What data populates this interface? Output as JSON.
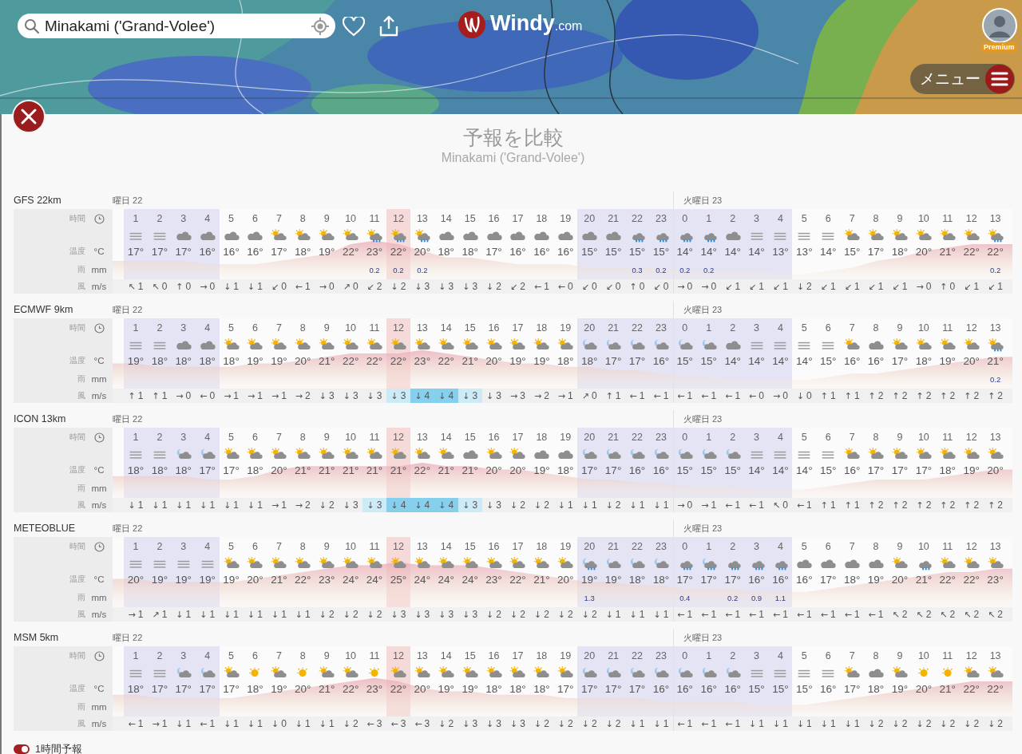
{
  "search": {
    "value": "Minakami ('Grand-Volee')"
  },
  "logo": {
    "name": "Windy",
    "suffix": ".com"
  },
  "account": {
    "badge": "Premium"
  },
  "menu": {
    "label": "メニュー"
  },
  "panel": {
    "title": "予報を比較",
    "subtitle": "Minakami ('Grand-Volee')"
  },
  "models": [
    {
      "name": "GFS 22km",
      "day": "曜日 22",
      "labels": {
        "time": "時間",
        "temperature": "温度",
        "temperature_unit": "°C",
        "rain": "雨",
        "rain_unit": "mm",
        "wind": "風",
        "wind_unit": "m/s"
      },
      "columns": [
        {
          "hour": "1",
          "kind": "fog",
          "temp": "17°",
          "wind": "1",
          "dir": "↖",
          "night": true,
          "now": false
        },
        {
          "hour": "2",
          "kind": "fog",
          "temp": "17°",
          "wind": "0",
          "dir": "↖",
          "night": true,
          "now": false
        },
        {
          "hour": "3",
          "kind": "cloud",
          "temp": "17°",
          "wind": "0",
          "dir": "↑",
          "night": true,
          "now": false
        },
        {
          "hour": "4",
          "kind": "cloud",
          "temp": "16°",
          "wind": "0",
          "dir": "→",
          "night": true,
          "now": false
        },
        {
          "hour": "5",
          "kind": "cloud",
          "temp": "16°",
          "wind": "1",
          "dir": "↓",
          "night": false,
          "now": false
        },
        {
          "hour": "6",
          "kind": "cloud",
          "temp": "16°",
          "wind": "1",
          "dir": "↓",
          "night": false,
          "now": false
        },
        {
          "hour": "7",
          "kind": "sun-cloud",
          "temp": "17°",
          "wind": "0",
          "dir": "↙",
          "night": false,
          "now": false
        },
        {
          "hour": "8",
          "kind": "sun-cloud",
          "temp": "18°",
          "wind": "1",
          "dir": "←",
          "night": false,
          "now": false
        },
        {
          "hour": "9",
          "kind": "sun-cloud",
          "temp": "19°",
          "wind": "0",
          "dir": "→",
          "night": false,
          "now": false
        },
        {
          "hour": "10",
          "kind": "sun-cloud",
          "temp": "22°",
          "wind": "0",
          "dir": "↗",
          "night": false,
          "now": false
        },
        {
          "hour": "11",
          "kind": "sun-cloud-rain",
          "temp": "23°",
          "rain": "0.2",
          "wind": "2",
          "dir": "↙",
          "night": false,
          "now": false
        },
        {
          "hour": "12",
          "kind": "sun-cloud-rain",
          "temp": "22°",
          "rain": "0.2",
          "wind": "2",
          "dir": "↓",
          "night": false,
          "now": true
        },
        {
          "hour": "13",
          "kind": "sun-cloud-rain",
          "temp": "20°",
          "rain": "0.2",
          "wind": "3",
          "dir": "↓",
          "night": false,
          "now": false
        },
        {
          "hour": "14",
          "kind": "cloud",
          "temp": "18°",
          "wind": "3",
          "dir": "↓",
          "night": false,
          "now": false
        },
        {
          "hour": "15",
          "kind": "cloud",
          "temp": "18°",
          "wind": "3",
          "dir": "↓",
          "night": false,
          "now": false
        },
        {
          "hour": "16",
          "kind": "cloud",
          "temp": "17°",
          "wind": "2",
          "dir": "↓",
          "night": false,
          "now": false
        },
        {
          "hour": "17",
          "kind": "cloud",
          "temp": "16°",
          "wind": "2",
          "dir": "↙",
          "night": false,
          "now": false
        },
        {
          "hour": "18",
          "kind": "cloud",
          "temp": "16°",
          "wind": "1",
          "dir": "←",
          "night": false,
          "now": false
        },
        {
          "hour": "19",
          "kind": "cloud",
          "temp": "16°",
          "wind": "0",
          "dir": "←",
          "night": false,
          "now": false
        },
        {
          "hour": "20",
          "kind": "cloud",
          "temp": "15°",
          "wind": "0",
          "dir": "↙",
          "night": true,
          "now": false
        },
        {
          "hour": "21",
          "kind": "cloud",
          "temp": "15°",
          "wind": "0",
          "dir": "↙",
          "night": true,
          "now": false
        },
        {
          "hour": "22",
          "kind": "cloud-rain",
          "temp": "15°",
          "rain": "0.3",
          "wind": "0",
          "dir": "↑",
          "night": true,
          "now": false
        },
        {
          "hour": "23",
          "kind": "cloud-rain",
          "temp": "15°",
          "rain": "0.2",
          "wind": "0",
          "dir": "↙",
          "night": true,
          "now": false
        },
        {
          "hour": "0",
          "kind": "cloud-rain",
          "temp": "14°",
          "rain": "0.2",
          "wind": "0",
          "dir": "→",
          "night": true,
          "now": false,
          "day": "火曜日 23"
        },
        {
          "hour": "1",
          "kind": "cloud-rain",
          "temp": "14°",
          "rain": "0.2",
          "wind": "0",
          "dir": "→",
          "night": true,
          "now": false
        },
        {
          "hour": "2",
          "kind": "cloud",
          "temp": "14°",
          "wind": "1",
          "dir": "↙",
          "night": true,
          "now": false
        },
        {
          "hour": "3",
          "kind": "fog",
          "temp": "14°",
          "wind": "1",
          "dir": "↙",
          "night": true,
          "now": false
        },
        {
          "hour": "4",
          "kind": "fog",
          "temp": "13°",
          "wind": "1",
          "dir": "↙",
          "night": true,
          "now": false
        },
        {
          "hour": "5",
          "kind": "fog",
          "temp": "13°",
          "wind": "2",
          "dir": "↓",
          "night": false,
          "now": false
        },
        {
          "hour": "6",
          "kind": "fog",
          "temp": "14°",
          "wind": "1",
          "dir": "↙",
          "night": false,
          "now": false
        },
        {
          "hour": "7",
          "kind": "sun-cloud",
          "temp": "15°",
          "wind": "1",
          "dir": "↙",
          "night": false,
          "now": false
        },
        {
          "hour": "8",
          "kind": "sun-cloud",
          "temp": "17°",
          "wind": "1",
          "dir": "↙",
          "night": false,
          "now": false
        },
        {
          "hour": "9",
          "kind": "sun-cloud",
          "temp": "18°",
          "wind": "1",
          "dir": "↙",
          "night": false,
          "now": false
        },
        {
          "hour": "10",
          "kind": "sun-cloud",
          "temp": "20°",
          "wind": "0",
          "dir": "→",
          "night": false,
          "now": false
        },
        {
          "hour": "11",
          "kind": "sun-cloud",
          "temp": "21°",
          "wind": "0",
          "dir": "↑",
          "night": false,
          "now": false
        },
        {
          "hour": "12",
          "kind": "sun-cloud",
          "temp": "22°",
          "wind": "1",
          "dir": "↙",
          "night": false,
          "now": false
        },
        {
          "hour": "13",
          "kind": "sun-cloud-rain",
          "temp": "22°",
          "rain": "0.2",
          "wind": "1",
          "dir": "↙",
          "night": false,
          "now": false
        }
      ]
    },
    {
      "name": "ECMWF 9km",
      "day": "曜日 22",
      "labels": {
        "time": "時間",
        "temperature": "温度",
        "temperature_unit": "°C",
        "rain": "雨",
        "rain_unit": "mm",
        "wind": "風",
        "wind_unit": "m/s"
      },
      "columns": [
        {
          "hour": "1",
          "kind": "fog",
          "temp": "19°",
          "wind": "1",
          "dir": "↑",
          "night": true,
          "now": false
        },
        {
          "hour": "2",
          "kind": "fog",
          "temp": "18°",
          "wind": "1",
          "dir": "↑",
          "night": true,
          "now": false
        },
        {
          "hour": "3",
          "kind": "cloud",
          "temp": "18°",
          "wind": "0",
          "dir": "→",
          "night": true,
          "now": false
        },
        {
          "hour": "4",
          "kind": "cloud",
          "temp": "18°",
          "wind": "0",
          "dir": "←",
          "night": true,
          "now": false
        },
        {
          "hour": "5",
          "kind": "sun-cloud",
          "temp": "18°",
          "wind": "1",
          "dir": "→",
          "night": false,
          "now": false
        },
        {
          "hour": "6",
          "kind": "sun-cloud",
          "temp": "19°",
          "wind": "1",
          "dir": "→",
          "night": false,
          "now": false
        },
        {
          "hour": "7",
          "kind": "sun-cloud",
          "temp": "19°",
          "wind": "1",
          "dir": "→",
          "night": false,
          "now": false
        },
        {
          "hour": "8",
          "kind": "sun-cloud",
          "temp": "20°",
          "wind": "2",
          "dir": "→",
          "night": false,
          "now": false
        },
        {
          "hour": "9",
          "kind": "sun-cloud",
          "temp": "21°",
          "wind": "3",
          "dir": "↓",
          "night": false,
          "now": false
        },
        {
          "hour": "10",
          "kind": "sun-cloud",
          "temp": "22°",
          "wind": "3",
          "dir": "↓",
          "night": false,
          "now": false
        },
        {
          "hour": "11",
          "kind": "sun-cloud",
          "temp": "22°",
          "wind": "3",
          "dir": "↓",
          "night": false,
          "now": false
        },
        {
          "hour": "12",
          "kind": "sun-cloud",
          "temp": "22°",
          "wind": "3",
          "dir": "↓",
          "highlight": true,
          "strong": false,
          "night": false,
          "now": true
        },
        {
          "hour": "13",
          "kind": "sun-cloud",
          "temp": "23°",
          "wind": "4",
          "dir": "↓",
          "highlight": true,
          "strong": true,
          "night": false,
          "now": false
        },
        {
          "hour": "14",
          "kind": "sun-cloud",
          "temp": "22°",
          "wind": "4",
          "dir": "↓",
          "highlight": true,
          "strong": true,
          "night": false,
          "now": false
        },
        {
          "hour": "15",
          "kind": "sun-cloud",
          "temp": "21°",
          "wind": "3",
          "dir": "↓",
          "highlight": true,
          "strong": false,
          "night": false,
          "now": false
        },
        {
          "hour": "16",
          "kind": "sun-cloud",
          "temp": "20°",
          "wind": "3",
          "dir": "↓",
          "night": false,
          "now": false
        },
        {
          "hour": "17",
          "kind": "sun-cloud",
          "temp": "19°",
          "wind": "3",
          "dir": "→",
          "night": false,
          "now": false
        },
        {
          "hour": "18",
          "kind": "sun-cloud",
          "temp": "19°",
          "wind": "2",
          "dir": "→",
          "night": false,
          "now": false
        },
        {
          "hour": "19",
          "kind": "sun-cloud",
          "temp": "18°",
          "wind": "1",
          "dir": "→",
          "night": false,
          "now": false
        },
        {
          "hour": "20",
          "kind": "moon-cloud",
          "temp": "18°",
          "wind": "0",
          "dir": "↗",
          "night": true,
          "now": false
        },
        {
          "hour": "21",
          "kind": "moon-cloud",
          "temp": "17°",
          "wind": "1",
          "dir": "↑",
          "night": true,
          "now": false
        },
        {
          "hour": "22",
          "kind": "moon-cloud",
          "temp": "17°",
          "wind": "1",
          "dir": "←",
          "night": true,
          "now": false
        },
        {
          "hour": "23",
          "kind": "moon-cloud",
          "temp": "16°",
          "wind": "1",
          "dir": "←",
          "night": true,
          "now": false
        },
        {
          "hour": "0",
          "kind": "moon-cloud",
          "temp": "15°",
          "wind": "1",
          "dir": "←",
          "night": true,
          "now": false,
          "day": "火曜日 23"
        },
        {
          "hour": "1",
          "kind": "moon-cloud",
          "temp": "15°",
          "wind": "1",
          "dir": "←",
          "night": true,
          "now": false
        },
        {
          "hour": "2",
          "kind": "cloud",
          "temp": "14°",
          "wind": "1",
          "dir": "←",
          "night": true,
          "now": false
        },
        {
          "hour": "3",
          "kind": "fog",
          "temp": "14°",
          "wind": "0",
          "dir": "←",
          "night": true,
          "now": false
        },
        {
          "hour": "4",
          "kind": "fog",
          "temp": "14°",
          "wind": "0",
          "dir": "→",
          "night": true,
          "now": false
        },
        {
          "hour": "5",
          "kind": "fog",
          "temp": "14°",
          "wind": "0",
          "dir": "↓",
          "night": false,
          "now": false
        },
        {
          "hour": "6",
          "kind": "fog",
          "temp": "15°",
          "wind": "1",
          "dir": "↑",
          "night": false,
          "now": false
        },
        {
          "hour": "7",
          "kind": "sun-cloud",
          "temp": "16°",
          "wind": "1",
          "dir": "↑",
          "night": false,
          "now": false
        },
        {
          "hour": "8",
          "kind": "cloud",
          "temp": "16°",
          "wind": "2",
          "dir": "↑",
          "night": false,
          "now": false
        },
        {
          "hour": "9",
          "kind": "sun-cloud",
          "temp": "17°",
          "wind": "2",
          "dir": "↑",
          "night": false,
          "now": false
        },
        {
          "hour": "10",
          "kind": "sun-cloud",
          "temp": "18°",
          "wind": "2",
          "dir": "↑",
          "night": false,
          "now": false
        },
        {
          "hour": "11",
          "kind": "sun-cloud",
          "temp": "19°",
          "wind": "2",
          "dir": "↑",
          "night": false,
          "now": false
        },
        {
          "hour": "12",
          "kind": "sun-cloud",
          "temp": "20°",
          "wind": "2",
          "dir": "↑",
          "night": false,
          "now": false
        },
        {
          "hour": "13",
          "kind": "sun-cloud-rain",
          "temp": "21°",
          "rain": "0.2",
          "wind": "2",
          "dir": "↑",
          "night": false,
          "now": false
        }
      ]
    },
    {
      "name": "ICON 13km",
      "day": "曜日 22",
      "labels": {
        "time": "時間",
        "temperature": "温度",
        "temperature_unit": "°C",
        "rain": "雨",
        "rain_unit": "mm",
        "wind": "風",
        "wind_unit": "m/s"
      },
      "columns": [
        {
          "hour": "1",
          "kind": "fog",
          "temp": "18°",
          "wind": "1",
          "dir": "↓",
          "night": true,
          "now": false
        },
        {
          "hour": "2",
          "kind": "fog",
          "temp": "18°",
          "wind": "1",
          "dir": "↓",
          "night": true,
          "now": false
        },
        {
          "hour": "3",
          "kind": "moon-cloud",
          "temp": "18°",
          "wind": "1",
          "dir": "↓",
          "night": true,
          "now": false
        },
        {
          "hour": "4",
          "kind": "moon-cloud",
          "temp": "17°",
          "wind": "1",
          "dir": "↓",
          "night": true,
          "now": false
        },
        {
          "hour": "5",
          "kind": "sun-cloud",
          "temp": "17°",
          "wind": "1",
          "dir": "↓",
          "night": false,
          "now": false
        },
        {
          "hour": "6",
          "kind": "sun-cloud",
          "temp": "18°",
          "wind": "1",
          "dir": "↓",
          "night": false,
          "now": false
        },
        {
          "hour": "7",
          "kind": "sun-cloud",
          "temp": "20°",
          "wind": "1",
          "dir": "→",
          "night": false,
          "now": false
        },
        {
          "hour": "8",
          "kind": "sun-cloud",
          "temp": "21°",
          "wind": "2",
          "dir": "→",
          "night": false,
          "now": false
        },
        {
          "hour": "9",
          "kind": "sun-cloud",
          "temp": "21°",
          "wind": "2",
          "dir": "↓",
          "night": false,
          "now": false
        },
        {
          "hour": "10",
          "kind": "sun-cloud",
          "temp": "21°",
          "wind": "3",
          "dir": "↓",
          "night": false,
          "now": false
        },
        {
          "hour": "11",
          "kind": "sun-cloud",
          "temp": "21°",
          "wind": "3",
          "dir": "↓",
          "highlight": true,
          "strong": false,
          "night": false,
          "now": false
        },
        {
          "hour": "12",
          "kind": "sun-cloud",
          "temp": "21°",
          "wind": "4",
          "dir": "↓",
          "highlight": true,
          "strong": true,
          "night": false,
          "now": true
        },
        {
          "hour": "13",
          "kind": "sun-cloud",
          "temp": "22°",
          "wind": "4",
          "dir": "↓",
          "highlight": true,
          "strong": true,
          "night": false,
          "now": false
        },
        {
          "hour": "14",
          "kind": "sun-cloud",
          "temp": "21°",
          "wind": "4",
          "dir": "↓",
          "highlight": true,
          "strong": true,
          "night": false,
          "now": false
        },
        {
          "hour": "15",
          "kind": "cloud",
          "temp": "21°",
          "wind": "3",
          "dir": "↓",
          "highlight": true,
          "strong": false,
          "night": false,
          "now": false
        },
        {
          "hour": "16",
          "kind": "sun-cloud",
          "temp": "20°",
          "wind": "3",
          "dir": "↓",
          "night": false,
          "now": false
        },
        {
          "hour": "17",
          "kind": "sun-cloud",
          "temp": "20°",
          "wind": "2",
          "dir": "↓",
          "night": false,
          "now": false
        },
        {
          "hour": "18",
          "kind": "cloud",
          "temp": "19°",
          "wind": "2",
          "dir": "↓",
          "night": false,
          "now": false
        },
        {
          "hour": "19",
          "kind": "cloud",
          "temp": "18°",
          "wind": "1",
          "dir": "↓",
          "night": false,
          "now": false
        },
        {
          "hour": "20",
          "kind": "moon-cloud",
          "temp": "17°",
          "wind": "1",
          "dir": "↓",
          "night": true,
          "now": false
        },
        {
          "hour": "21",
          "kind": "moon-cloud",
          "temp": "17°",
          "wind": "2",
          "dir": "↓",
          "night": true,
          "now": false
        },
        {
          "hour": "22",
          "kind": "moon-cloud",
          "temp": "16°",
          "wind": "1",
          "dir": "↓",
          "night": true,
          "now": false
        },
        {
          "hour": "23",
          "kind": "moon-cloud",
          "temp": "16°",
          "wind": "1",
          "dir": "↓",
          "night": true,
          "now": false
        },
        {
          "hour": "0",
          "kind": "moon-cloud",
          "temp": "15°",
          "wind": "0",
          "dir": "→",
          "night": true,
          "now": false,
          "day": "火曜日 23"
        },
        {
          "hour": "1",
          "kind": "moon-cloud",
          "temp": "15°",
          "wind": "1",
          "dir": "→",
          "night": true,
          "now": false
        },
        {
          "hour": "2",
          "kind": "moon-cloud",
          "temp": "15°",
          "wind": "1",
          "dir": "←",
          "night": true,
          "now": false
        },
        {
          "hour": "3",
          "kind": "fog",
          "temp": "14°",
          "wind": "1",
          "dir": "←",
          "night": true,
          "now": false
        },
        {
          "hour": "4",
          "kind": "fog",
          "temp": "14°",
          "wind": "0",
          "dir": "↖",
          "night": true,
          "now": false
        },
        {
          "hour": "5",
          "kind": "fog",
          "temp": "14°",
          "wind": "1",
          "dir": "←",
          "night": false,
          "now": false
        },
        {
          "hour": "6",
          "kind": "fog",
          "temp": "15°",
          "wind": "1",
          "dir": "↑",
          "night": false,
          "now": false
        },
        {
          "hour": "7",
          "kind": "sun-cloud",
          "temp": "16°",
          "wind": "1",
          "dir": "↑",
          "night": false,
          "now": false
        },
        {
          "hour": "8",
          "kind": "sun-cloud",
          "temp": "17°",
          "wind": "2",
          "dir": "↑",
          "night": false,
          "now": false
        },
        {
          "hour": "9",
          "kind": "sun-cloud",
          "temp": "17°",
          "wind": "2",
          "dir": "↑",
          "night": false,
          "now": false
        },
        {
          "hour": "10",
          "kind": "sun-cloud",
          "temp": "17°",
          "wind": "2",
          "dir": "↑",
          "night": false,
          "now": false
        },
        {
          "hour": "11",
          "kind": "sun-cloud",
          "temp": "18°",
          "wind": "2",
          "dir": "↑",
          "night": false,
          "now": false
        },
        {
          "hour": "12",
          "kind": "sun-cloud",
          "temp": "19°",
          "wind": "2",
          "dir": "↑",
          "night": false,
          "now": false
        },
        {
          "hour": "13",
          "kind": "sun-cloud",
          "temp": "20°",
          "wind": "2",
          "dir": "↑",
          "night": false,
          "now": false
        }
      ]
    },
    {
      "name": "METEOBLUE",
      "day": "曜日 22",
      "labels": {
        "time": "時間",
        "temperature": "温度",
        "temperature_unit": "°C",
        "rain": "雨",
        "rain_unit": "mm",
        "wind": "風",
        "wind_unit": "m/s"
      },
      "columns": [
        {
          "hour": "1",
          "kind": "fog",
          "temp": "20°",
          "wind": "1",
          "dir": "→",
          "night": true,
          "now": false
        },
        {
          "hour": "2",
          "kind": "fog",
          "temp": "19°",
          "wind": "1",
          "dir": "↗",
          "night": true,
          "now": false
        },
        {
          "hour": "3",
          "kind": "fog",
          "temp": "19°",
          "wind": "1",
          "dir": "↓",
          "night": true,
          "now": false
        },
        {
          "hour": "4",
          "kind": "fog",
          "temp": "19°",
          "wind": "1",
          "dir": "↓",
          "night": true,
          "now": false
        },
        {
          "hour": "5",
          "kind": "sun-cloud",
          "temp": "19°",
          "wind": "1",
          "dir": "↓",
          "night": false,
          "now": false
        },
        {
          "hour": "6",
          "kind": "sun-cloud",
          "temp": "20°",
          "wind": "1",
          "dir": "↓",
          "night": false,
          "now": false
        },
        {
          "hour": "7",
          "kind": "sun-cloud",
          "temp": "21°",
          "wind": "1",
          "dir": "↓",
          "night": false,
          "now": false
        },
        {
          "hour": "8",
          "kind": "sun-cloud",
          "temp": "22°",
          "wind": "1",
          "dir": "↓",
          "night": false,
          "now": false
        },
        {
          "hour": "9",
          "kind": "sun-cloud",
          "temp": "23°",
          "wind": "2",
          "dir": "↓",
          "night": false,
          "now": false
        },
        {
          "hour": "10",
          "kind": "sun-cloud",
          "temp": "24°",
          "wind": "2",
          "dir": "↓",
          "night": false,
          "now": false
        },
        {
          "hour": "11",
          "kind": "sun-cloud",
          "temp": "24°",
          "wind": "2",
          "dir": "↓",
          "night": false,
          "now": false
        },
        {
          "hour": "12",
          "kind": "sun-cloud",
          "temp": "25°",
          "wind": "3",
          "dir": "↓",
          "night": false,
          "now": true
        },
        {
          "hour": "13",
          "kind": "sun-cloud",
          "temp": "24°",
          "wind": "3",
          "dir": "↓",
          "night": false,
          "now": false
        },
        {
          "hour": "14",
          "kind": "sun-cloud",
          "temp": "24°",
          "wind": "3",
          "dir": "↓",
          "night": false,
          "now": false
        },
        {
          "hour": "15",
          "kind": "sun-cloud",
          "temp": "24°",
          "wind": "3",
          "dir": "↓",
          "night": false,
          "now": false
        },
        {
          "hour": "16",
          "kind": "sun-cloud",
          "temp": "23°",
          "wind": "2",
          "dir": "↓",
          "night": false,
          "now": false
        },
        {
          "hour": "17",
          "kind": "sun-cloud",
          "temp": "22°",
          "wind": "2",
          "dir": "↓",
          "night": false,
          "now": false
        },
        {
          "hour": "18",
          "kind": "sun-cloud",
          "temp": "21°",
          "wind": "2",
          "dir": "↓",
          "night": false,
          "now": false
        },
        {
          "hour": "19",
          "kind": "sun-cloud",
          "temp": "20°",
          "wind": "2",
          "dir": "↓",
          "night": false,
          "now": false
        },
        {
          "hour": "20",
          "kind": "moon-cloud-rain",
          "temp": "19°",
          "rain": "1.3",
          "wind": "2",
          "dir": "↓",
          "night": true,
          "now": false
        },
        {
          "hour": "21",
          "kind": "moon-cloud",
          "temp": "19°",
          "wind": "1",
          "dir": "↓",
          "night": true,
          "now": false
        },
        {
          "hour": "22",
          "kind": "moon-cloud",
          "temp": "18°",
          "wind": "1",
          "dir": "↓",
          "night": true,
          "now": false
        },
        {
          "hour": "23",
          "kind": "moon-cloud",
          "temp": "18°",
          "wind": "1",
          "dir": "↓",
          "night": true,
          "now": false
        },
        {
          "hour": "0",
          "kind": "cloud-rain",
          "temp": "17°",
          "rain": "0.4",
          "wind": "1",
          "dir": "←",
          "night": true,
          "now": false,
          "day": "火曜日 23"
        },
        {
          "hour": "1",
          "kind": "moon-cloud-rain",
          "temp": "17°",
          "wind": "1",
          "dir": "←",
          "night": true,
          "now": false
        },
        {
          "hour": "2",
          "kind": "cloud-rain",
          "temp": "17°",
          "rain": "0.2",
          "wind": "1",
          "dir": "←",
          "night": true,
          "now": false
        },
        {
          "hour": "3",
          "kind": "cloud-rain",
          "temp": "16°",
          "rain": "0.9",
          "wind": "1",
          "dir": "←",
          "night": true,
          "now": false
        },
        {
          "hour": "4",
          "kind": "cloud-rain",
          "temp": "16°",
          "rain": "1.1",
          "wind": "1",
          "dir": "←",
          "night": true,
          "now": false
        },
        {
          "hour": "5",
          "kind": "cloud",
          "temp": "16°",
          "wind": "1",
          "dir": "←",
          "night": false,
          "now": false
        },
        {
          "hour": "6",
          "kind": "cloud",
          "temp": "17°",
          "wind": "1",
          "dir": "←",
          "night": false,
          "now": false
        },
        {
          "hour": "7",
          "kind": "cloud",
          "temp": "18°",
          "wind": "1",
          "dir": "←",
          "night": false,
          "now": false
        },
        {
          "hour": "8",
          "kind": "cloud",
          "temp": "19°",
          "wind": "1",
          "dir": "←",
          "night": false,
          "now": false
        },
        {
          "hour": "9",
          "kind": "sun-cloud",
          "temp": "20°",
          "wind": "2",
          "dir": "↖",
          "night": false,
          "now": false
        },
        {
          "hour": "10",
          "kind": "cloud-rain",
          "temp": "21°",
          "wind": "2",
          "dir": "↖",
          "night": false,
          "now": false
        },
        {
          "hour": "11",
          "kind": "sun-cloud",
          "temp": "22°",
          "wind": "2",
          "dir": "↖",
          "night": false,
          "now": false
        },
        {
          "hour": "12",
          "kind": "sun-cloud",
          "temp": "22°",
          "wind": "2",
          "dir": "↖",
          "night": false,
          "now": false
        },
        {
          "hour": "13",
          "kind": "sun-cloud",
          "temp": "23°",
          "wind": "2",
          "dir": "↖",
          "night": false,
          "now": false
        }
      ]
    },
    {
      "name": "MSM 5km",
      "day": "曜日 22",
      "labels": {
        "time": "時間",
        "temperature": "温度",
        "temperature_unit": "°C",
        "rain": "雨",
        "rain_unit": "mm",
        "wind": "風",
        "wind_unit": "m/s"
      },
      "columns": [
        {
          "hour": "1",
          "kind": "fog",
          "temp": "18°",
          "wind": "1",
          "dir": "←",
          "night": true,
          "now": false
        },
        {
          "hour": "2",
          "kind": "fog",
          "temp": "17°",
          "wind": "1",
          "dir": "→",
          "night": true,
          "now": false
        },
        {
          "hour": "3",
          "kind": "moon-cloud",
          "temp": "17°",
          "wind": "1",
          "dir": "↓",
          "night": true,
          "now": false
        },
        {
          "hour": "4",
          "kind": "moon-cloud",
          "temp": "17°",
          "wind": "1",
          "dir": "←",
          "night": true,
          "now": false
        },
        {
          "hour": "5",
          "kind": "sun-cloud",
          "temp": "17°",
          "wind": "1",
          "dir": "↓",
          "night": false,
          "now": false
        },
        {
          "hour": "6",
          "kind": "sun",
          "temp": "18°",
          "wind": "1",
          "dir": "↓",
          "night": false,
          "now": false
        },
        {
          "hour": "7",
          "kind": "sun-cloud",
          "temp": "19°",
          "wind": "0",
          "dir": "↓",
          "night": false,
          "now": false
        },
        {
          "hour": "8",
          "kind": "sun",
          "temp": "20°",
          "wind": "1",
          "dir": "↓",
          "night": false,
          "now": false
        },
        {
          "hour": "9",
          "kind": "sun-cloud",
          "temp": "21°",
          "wind": "1",
          "dir": "↓",
          "night": false,
          "now": false
        },
        {
          "hour": "10",
          "kind": "sun-cloud",
          "temp": "22°",
          "wind": "2",
          "dir": "↓",
          "night": false,
          "now": false
        },
        {
          "hour": "11",
          "kind": "sun",
          "temp": "23°",
          "wind": "3",
          "dir": "←",
          "night": false,
          "now": false
        },
        {
          "hour": "12",
          "kind": "sun-cloud",
          "temp": "22°",
          "wind": "3",
          "dir": "←",
          "night": false,
          "now": true
        },
        {
          "hour": "13",
          "kind": "sun-cloud",
          "temp": "20°",
          "wind": "3",
          "dir": "←",
          "night": false,
          "now": false
        },
        {
          "hour": "14",
          "kind": "sun-cloud",
          "temp": "19°",
          "wind": "2",
          "dir": "↓",
          "night": false,
          "now": false
        },
        {
          "hour": "15",
          "kind": "sun-cloud",
          "temp": "19°",
          "wind": "3",
          "dir": "↓",
          "night": false,
          "now": false
        },
        {
          "hour": "16",
          "kind": "sun-cloud",
          "temp": "18°",
          "wind": "3",
          "dir": "↓",
          "night": false,
          "now": false
        },
        {
          "hour": "17",
          "kind": "sun-cloud",
          "temp": "18°",
          "wind": "3",
          "dir": "↓",
          "night": false,
          "now": false
        },
        {
          "hour": "18",
          "kind": "sun-cloud",
          "temp": "18°",
          "wind": "2",
          "dir": "↓",
          "night": false,
          "now": false
        },
        {
          "hour": "19",
          "kind": "sun-cloud",
          "temp": "17°",
          "wind": "2",
          "dir": "↓",
          "night": false,
          "now": false
        },
        {
          "hour": "20",
          "kind": "moon-cloud",
          "temp": "17°",
          "wind": "2",
          "dir": "↓",
          "night": true,
          "now": false
        },
        {
          "hour": "21",
          "kind": "moon-cloud",
          "temp": "17°",
          "wind": "2",
          "dir": "↓",
          "night": true,
          "now": false
        },
        {
          "hour": "22",
          "kind": "moon-cloud",
          "temp": "17°",
          "wind": "1",
          "dir": "↓",
          "night": true,
          "now": false
        },
        {
          "hour": "23",
          "kind": "moon-cloud",
          "temp": "16°",
          "wind": "1",
          "dir": "↓",
          "night": true,
          "now": false
        },
        {
          "hour": "0",
          "kind": "moon-cloud",
          "temp": "16°",
          "wind": "1",
          "dir": "←",
          "night": true,
          "now": false,
          "day": "火曜日 23"
        },
        {
          "hour": "1",
          "kind": "moon-cloud",
          "temp": "16°",
          "wind": "1",
          "dir": "←",
          "night": true,
          "now": false
        },
        {
          "hour": "2",
          "kind": "moon-cloud",
          "temp": "16°",
          "wind": "1",
          "dir": "←",
          "night": true,
          "now": false
        },
        {
          "hour": "3",
          "kind": "fog",
          "temp": "15°",
          "wind": "1",
          "dir": "↓",
          "night": true,
          "now": false
        },
        {
          "hour": "4",
          "kind": "fog",
          "temp": "15°",
          "wind": "1",
          "dir": "↓",
          "night": true,
          "now": false
        },
        {
          "hour": "5",
          "kind": "fog",
          "temp": "15°",
          "wind": "1",
          "dir": "↓",
          "night": false,
          "now": false
        },
        {
          "hour": "6",
          "kind": "fog",
          "temp": "16°",
          "wind": "1",
          "dir": "↓",
          "night": false,
          "now": false
        },
        {
          "hour": "7",
          "kind": "sun-cloud",
          "temp": "17°",
          "wind": "1",
          "dir": "↓",
          "night": false,
          "now": false
        },
        {
          "hour": "8",
          "kind": "cloud",
          "temp": "18°",
          "wind": "2",
          "dir": "↓",
          "night": false,
          "now": false
        },
        {
          "hour": "9",
          "kind": "sun-cloud",
          "temp": "19°",
          "wind": "2",
          "dir": "↓",
          "night": false,
          "now": false
        },
        {
          "hour": "10",
          "kind": "sun",
          "temp": "20°",
          "wind": "2",
          "dir": "↓",
          "night": false,
          "now": false
        },
        {
          "hour": "11",
          "kind": "sun",
          "temp": "21°",
          "wind": "2",
          "dir": "↓",
          "night": false,
          "now": false
        },
        {
          "hour": "12",
          "kind": "sun-cloud",
          "temp": "22°",
          "wind": "2",
          "dir": "↓",
          "night": false,
          "now": false
        },
        {
          "hour": "13",
          "kind": "sun-cloud",
          "temp": "22°",
          "wind": "2",
          "dir": "↓",
          "night": false,
          "now": false
        }
      ]
    }
  ],
  "hourly_toggle": {
    "label": "1時間予報",
    "on": true
  }
}
